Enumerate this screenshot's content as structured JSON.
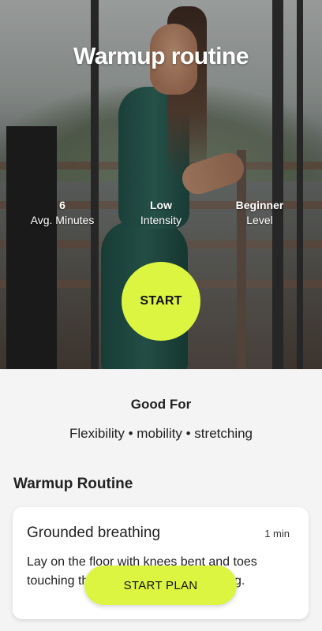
{
  "hero": {
    "title": "Warmup routine",
    "stats": [
      {
        "value": "6",
        "label": "Avg. Minutes"
      },
      {
        "value": "Low",
        "label": "Intensity"
      },
      {
        "value": "Beginner",
        "label": "Level"
      }
    ],
    "start_label": "START"
  },
  "good_for": {
    "title": "Good For",
    "tags": "Flexibility • mobility • stretching"
  },
  "routine": {
    "section_title": "Warmup Routine",
    "items": [
      {
        "title": "Grounded breathing",
        "duration": "1 min",
        "description": "Lay on the floor with knees bent and toes touching the floor. Take slow breathing."
      }
    ]
  },
  "cta": {
    "start_plan_label": "START PLAN"
  },
  "colors": {
    "accent": "#dcf541",
    "background": "#f4f4f4",
    "card": "#ffffff",
    "text": "#222222"
  }
}
